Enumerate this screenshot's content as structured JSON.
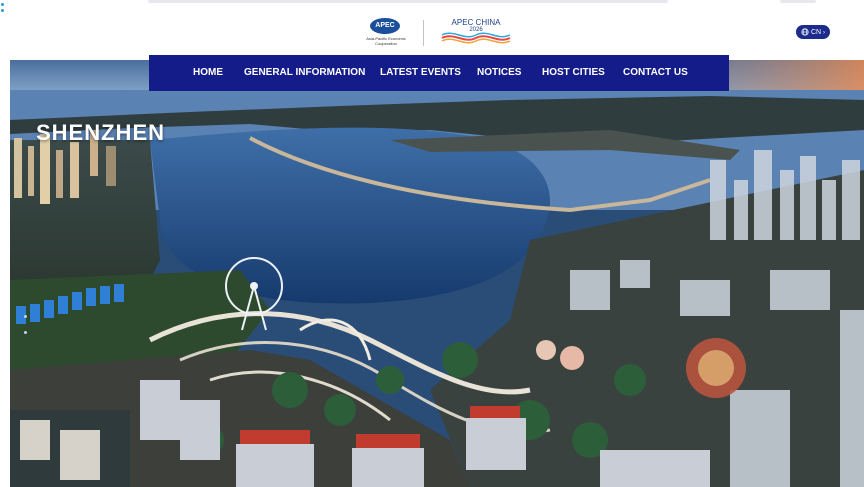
{
  "header": {
    "logo_apec": {
      "badge": "APEC",
      "subtitle": "Asia-Pacific Economic Cooperation",
      "icon": "apec-logo-icon"
    },
    "logo_china": {
      "title": "APEC CHINA",
      "year": "2026",
      "icon": "apec-china-2026-logo-icon"
    },
    "language": {
      "label": "CN",
      "icon": "globe-icon",
      "chevron": "chevron-right-icon"
    }
  },
  "nav": {
    "items": [
      {
        "label": "HOME"
      },
      {
        "label": "GENERAL INFORMATION"
      },
      {
        "label": "LATEST EVENTS"
      },
      {
        "label": "NOTICES"
      },
      {
        "label": "HOST CITIES"
      },
      {
        "label": "CONTACT US"
      }
    ]
  },
  "hero": {
    "city": "SHENZHEN",
    "image": "shenzhen-bay-aerial-photo"
  },
  "colors": {
    "nav_bg": "#141c8a",
    "brand_blue": "#1f3f8a",
    "lang_bg": "#1c2b8c"
  }
}
